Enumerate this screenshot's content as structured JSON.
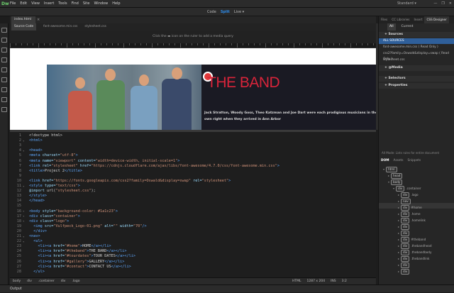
{
  "menubar": {
    "logo": "Dw",
    "items": [
      "File",
      "Edit",
      "View",
      "Insert",
      "Tools",
      "Find",
      "Site",
      "Window",
      "Help"
    ],
    "workspace": "Standard ▾",
    "controls": [
      "—",
      "❐",
      "✕"
    ]
  },
  "viewmodes": {
    "code": "Code",
    "split": "Split",
    "live": "Live ▾"
  },
  "document": {
    "tab_label": "index.html",
    "close": "×",
    "file_tabs": [
      "Source Code",
      "font-awesome.min.css",
      "stylesheet.css"
    ],
    "mq_hint": "Click the ▬ icon on the ruler to add a media query"
  },
  "live_view": {
    "title": "THE BAND",
    "description": "Jack Stratton, Woody Goss, Theo Katzman and Joe Dart were each prodigious musicians in their own right when they arrived in Ann Arbor"
  },
  "code_lines": [
    {
      "n": "1",
      "html": "<span class='tx'>&lt;!doctype html&gt;</span>"
    },
    {
      "n": "2",
      "html": "<span class='tg'>&lt;html&gt;</span>"
    },
    {
      "n": "3",
      "html": ""
    },
    {
      "n": "4",
      "html": "<span class='tg'>&lt;head&gt;</span>"
    },
    {
      "n": "5",
      "html": "<span class='tg'>&lt;meta</span> <span class='at'>charset=</span><span class='st'>\"utf-8\"</span><span class='tg'>&gt;</span>"
    },
    {
      "n": "6",
      "html": "<span class='tg'>&lt;meta</span> <span class='at'>name=</span><span class='st'>\"viewport\"</span> <span class='at'>content=</span><span class='st'>\"width=device-width, initial-scale=1\"</span><span class='tg'>&gt;</span>"
    },
    {
      "n": "7",
      "html": "<span class='tg'>&lt;link</span> <span class='at'>rel=</span><span class='st'>\"stylesheet\"</span> <span class='at'>href=</span><span class='st'>\"https://cdnjs.cloudflare.com/ajax/libs/font-awesome/4.7.0/css/font-awesome.min.css\"</span><span class='tg'>&gt;</span>"
    },
    {
      "n": "8",
      "html": "<span class='tg'>&lt;title&gt;</span><span class='tx'>Project 2</span><span class='tg'>&lt;/title&gt;</span>"
    },
    {
      "n": "9",
      "html": ""
    },
    {
      "n": "10",
      "html": "<span class='tg'>&lt;link</span> <span class='at'>href=</span><span class='st'>\"https://fonts.googleapis.com/css2?family=Oswald&amp;display=swap\"</span> <span class='at'>rel=</span><span class='st'>\"stylesheet\"</span><span class='tg'>&gt;</span>"
    },
    {
      "n": "11",
      "html": "<span class='tg'>&lt;style</span> <span class='at'>type=</span><span class='st'>\"text/css\"</span><span class='tg'>&gt;</span>"
    },
    {
      "n": "12",
      "html": "<span class='at'>@import</span> <span class='tx'>url(</span><span class='st'>\"stylesheet.css\"</span><span class='tx'>);</span>"
    },
    {
      "n": "13",
      "html": "<span class='tg'>&lt;/style&gt;</span>"
    },
    {
      "n": "14",
      "html": "<span class='tg'>&lt;/head&gt;</span>"
    },
    {
      "n": "15",
      "html": ""
    },
    {
      "n": "16",
      "html": "<span class='tg'>&lt;body</span> <span class='at'>style=</span><span class='st'>\"background-color: #1a1c23\"</span><span class='tg'>&gt;</span>"
    },
    {
      "n": "17",
      "html": "<span class='tg'>&lt;div</span> <span class='at'>class=</span><span class='st'>\"container\"</span><span class='tg'>&gt;</span>"
    },
    {
      "n": "18",
      "html": "<span class='tg'>&lt;div</span> <span class='at'>class=</span><span class='st'>\"logo\"</span><span class='tg'>&gt;</span>"
    },
    {
      "n": "19",
      "html": "  <span class='tg'>&lt;img</span> <span class='at'>src=</span><span class='st'>\"Vulfpeck_Logo-01.png\"</span> <span class='at'>alt=</span><span class='st'>\"\"</span> <span class='at'>width=</span><span class='st'>\"70\"</span><span class='tg'>/&gt;</span>"
    },
    {
      "n": "20",
      "html": "  <span class='tg'>&lt;/div&gt;</span>"
    },
    {
      "n": "21",
      "html": "<span class='tg'>&lt;nav&gt;</span>"
    },
    {
      "n": "22",
      "html": "  <span class='tg'>&lt;ul&gt;</span>"
    },
    {
      "n": "23",
      "html": "    <span class='tg'>&lt;li&gt;&lt;a</span> <span class='at'>href=</span><span class='st'>\"#home\"</span><span class='tg'>&gt;</span><span class='tx'>HOME</span><span class='tg'>&lt;/a&gt;&lt;/li&gt;</span>"
    },
    {
      "n": "24",
      "html": "    <span class='tg'>&lt;li&gt;&lt;a</span> <span class='at'>href=</span><span class='st'>\"#theband\"</span><span class='tg'>&gt;</span><span class='tx'>THE BAND</span><span class='tg'>&lt;/a&gt;&lt;/li&gt;</span>"
    },
    {
      "n": "25",
      "html": "    <span class='tg'>&lt;li&gt;&lt;a</span> <span class='at'>href=</span><span class='st'>\"#tourdates\"</span><span class='tg'>&gt;</span><span class='tx'>TOUR DATES</span><span class='tg'>&lt;/a&gt;&lt;/li&gt;</span>"
    },
    {
      "n": "26",
      "html": "    <span class='tg'>&lt;li&gt;&lt;a</span> <span class='at'>href=</span><span class='st'>\"#gallery\"</span><span class='tg'>&gt;</span><span class='tx'>GALLERY</span><span class='tg'>&lt;/a&gt;&lt;/li&gt;</span>"
    },
    {
      "n": "27",
      "html": "    <span class='tg'>&lt;li&gt;&lt;a</span> <span class='at'>href=</span><span class='st'>\"#contact\"</span><span class='tg'>&gt;</span><span class='tx'>CONTACT US</span><span class='tg'>&lt;/a&gt;&lt;/li&gt;</span>"
    },
    {
      "n": "28",
      "html": "  <span class='tg'>&lt;/ul&gt;</span>"
    }
  ],
  "statusbar": {
    "crumbs": [
      "body",
      "div",
      ".container",
      "div",
      ".logo"
    ],
    "lang": "HTML",
    "size": "1287 x 204",
    "mode": "INS",
    "pos": "3:2"
  },
  "output_label": "Output",
  "rightpanel": {
    "tabs": [
      "Files",
      "CC Libraries",
      "Insert",
      "CSS Designer"
    ],
    "sub": [
      "All",
      "Current"
    ],
    "sources_h": "+ Sources",
    "sources": [
      "ALL SOURCES",
      "font-awesome.min.css ( Read Only )",
      "css2?family=Oswald&display=swap ( Read Only )",
      "stylesheet.css"
    ],
    "media_h": "+ @Media",
    "selectors_h": "+ Selectors",
    "properties_h": "+ Properties",
    "mode_note": "All Mode: Lists rules for entire document",
    "dom_tabs": [
      "DOM",
      "Assets",
      "Snippets"
    ]
  },
  "dom_tree": [
    {
      "tag": "html",
      "cls": "",
      "d": 0,
      "arrow": "▾"
    },
    {
      "tag": "head",
      "cls": "",
      "d": 1,
      "arrow": "▸"
    },
    {
      "tag": "body",
      "cls": "",
      "d": 1,
      "arrow": "▾"
    },
    {
      "tag": "div",
      "cls": ".container",
      "d": 2,
      "arrow": "▾"
    },
    {
      "tag": "div",
      "cls": ".logo",
      "d": 3,
      "arrow": "▸"
    },
    {
      "tag": "nav",
      "cls": "",
      "d": 3,
      "arrow": "▸"
    },
    {
      "tag": "div",
      "cls": "#home",
      "d": 3,
      "arrow": "▸"
    },
    {
      "tag": "div",
      "cls": ".home",
      "d": 3,
      "arrow": "▸"
    },
    {
      "tag": "div",
      "cls": ".homelink",
      "d": 3,
      "arrow": "▸"
    },
    {
      "tag": "div",
      "cls": "",
      "d": 3,
      "arrow": "▸"
    },
    {
      "tag": "div",
      "cls": "",
      "d": 3,
      "arrow": "▸"
    },
    {
      "tag": "div",
      "cls": "#theband",
      "d": 3,
      "arrow": "▸"
    },
    {
      "tag": "div",
      "cls": ".thebandhead",
      "d": 3,
      "arrow": "▸"
    },
    {
      "tag": "div",
      "cls": ".thebandbody",
      "d": 3,
      "arrow": "▸"
    },
    {
      "tag": "div",
      "cls": ".thebandlink",
      "d": 3,
      "arrow": "▸"
    },
    {
      "tag": "div",
      "cls": "",
      "d": 3,
      "arrow": "▸"
    },
    {
      "tag": "div",
      "cls": "",
      "d": 3,
      "arrow": "▸"
    }
  ]
}
